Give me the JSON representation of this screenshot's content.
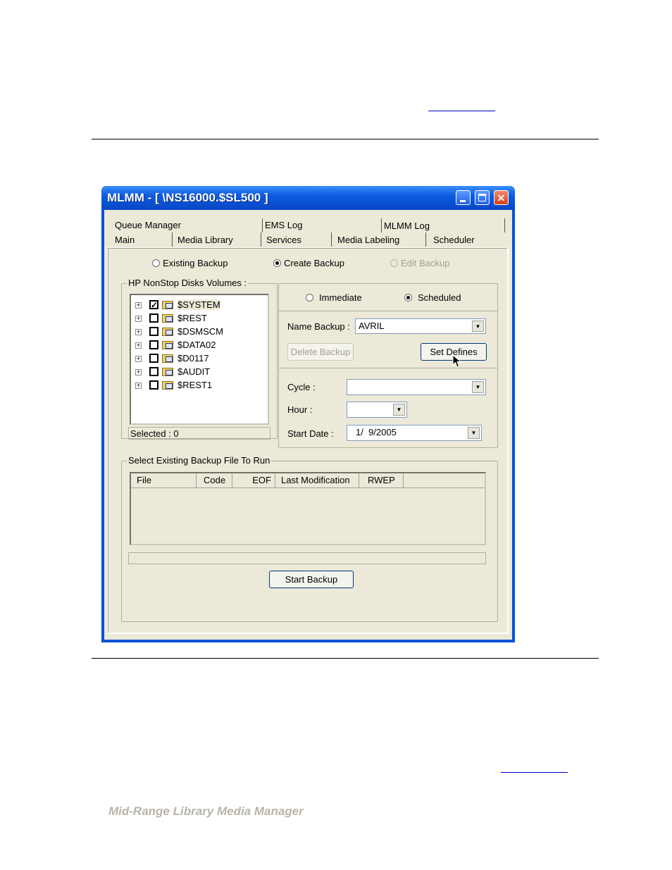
{
  "window": {
    "title": "MLMM - [ \\NS16000.$SL500 ]",
    "footer": "Mid-Range Library Media Manager"
  },
  "tabs_row1": [
    "Queue Manager",
    "EMS Log",
    "MLMM Log"
  ],
  "tabs_row2": [
    "Main",
    "Media Library",
    "Services",
    "Media Labeling",
    "Scheduler"
  ],
  "backup_mode": {
    "existing": "Existing Backup",
    "create": "Create Backup",
    "edit": "Edit Backup",
    "selected": "Create Backup"
  },
  "volumes": {
    "label": "HP NonStop Disks Volumes :",
    "items": [
      {
        "name": "$SYSTEM",
        "checked": true
      },
      {
        "name": "$REST",
        "checked": false
      },
      {
        "name": "$DSMSCM",
        "checked": false
      },
      {
        "name": "$DATA02",
        "checked": false
      },
      {
        "name": "$D0117",
        "checked": false
      },
      {
        "name": "$AUDIT",
        "checked": false
      },
      {
        "name": "$REST1",
        "checked": false
      }
    ],
    "selected_text": "Selected : 0"
  },
  "schedule": {
    "immediate": "Immediate",
    "scheduled": "Scheduled",
    "selected": "Scheduled"
  },
  "name_backup": {
    "label": "Name Backup :",
    "value": "AVRIL"
  },
  "buttons": {
    "delete": "Delete Backup",
    "set_defines": "Set Defines",
    "start": "Start Backup"
  },
  "cycle": {
    "label": "Cycle :",
    "value": ""
  },
  "hour": {
    "label": "Hour :",
    "value": ""
  },
  "start_date": {
    "label": "Start Date :",
    "value": "1/  9/2005"
  },
  "existing_files": {
    "label": "Select Existing Backup File To Run",
    "columns": [
      "File",
      "Code",
      "EOF",
      "Last Modification",
      "RWEP"
    ]
  },
  "icons": [
    "minimize-icon",
    "maximize-icon",
    "close-icon",
    "expand-plus-icon",
    "folder-disk-icon",
    "dropdown-arrow-icon",
    "mouse-cursor-icon"
  ]
}
